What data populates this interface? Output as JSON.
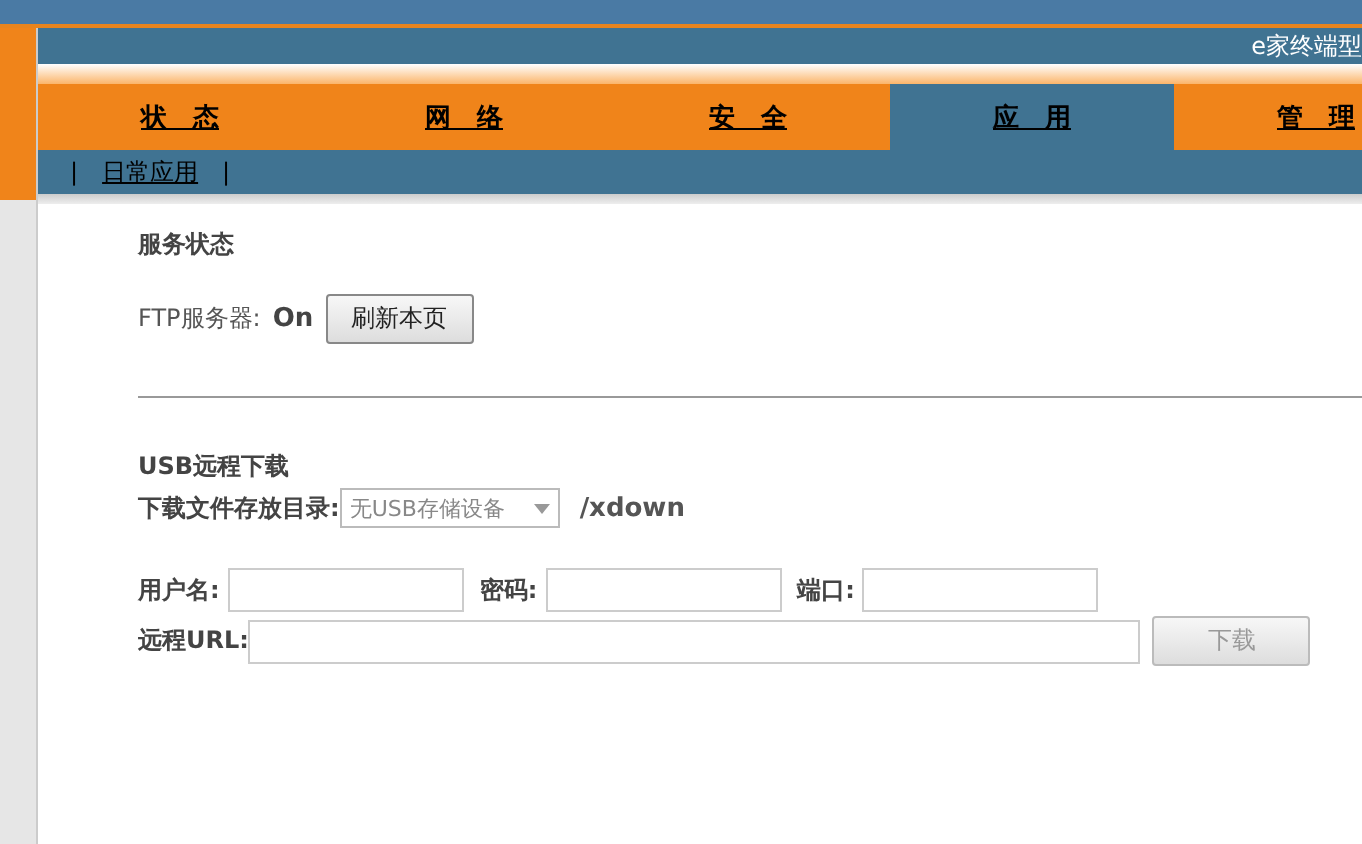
{
  "header": {
    "title": "e家终端型"
  },
  "tabs": [
    {
      "label": "状　态",
      "selected": false
    },
    {
      "label": "网　络",
      "selected": false
    },
    {
      "label": "安　全",
      "selected": false
    },
    {
      "label": "应　用",
      "selected": true
    },
    {
      "label": "管　理",
      "selected": false
    }
  ],
  "subnav": {
    "separator_left": "|",
    "items": [
      {
        "label": "日常应用"
      }
    ],
    "separator_right": "|"
  },
  "service_status": {
    "heading": "服务状态",
    "label": "FTP服务器:",
    "value": "On",
    "refresh_button": "刷新本页"
  },
  "usb_download": {
    "heading": "USB远程下载",
    "dir_label": "下载文件存放目录:",
    "dir_select": {
      "value": "无USB存储设备",
      "disabled": true
    },
    "dir_suffix": "/xdown",
    "username_label": "用户名:",
    "password_label": "密码:",
    "port_label": "端口:",
    "url_label": "远程URL:",
    "download_button": {
      "label": "下载",
      "disabled": true
    }
  }
}
